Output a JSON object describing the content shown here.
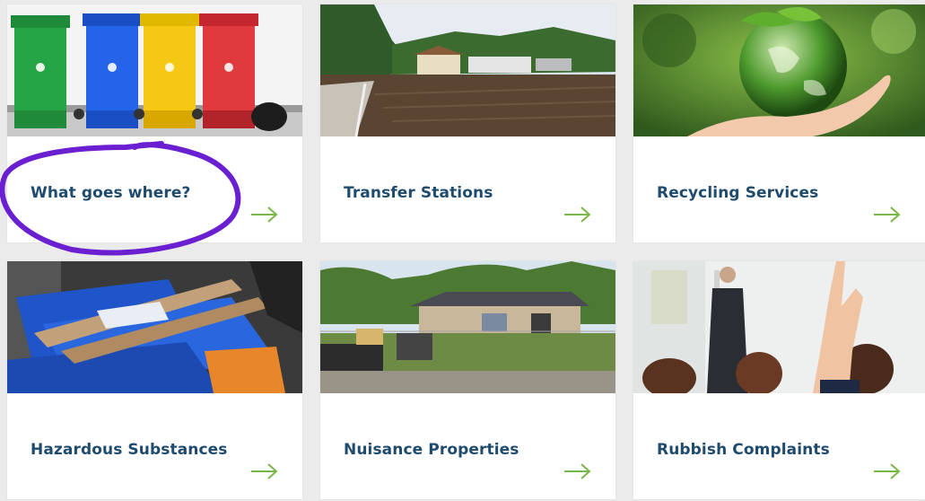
{
  "cards": [
    {
      "title": "What goes where?"
    },
    {
      "title": "Transfer Stations"
    },
    {
      "title": "Recycling Services"
    },
    {
      "title": "Hazardous Substances"
    },
    {
      "title": "Nuisance Properties"
    },
    {
      "title": "Rubbish Complaints"
    }
  ],
  "colors": {
    "title": "#1f4b6e",
    "arrow": "#7ab648",
    "annotation": "#6a1fd0",
    "card_bg": "#ffffff",
    "page_bg": "#ebebeb"
  },
  "icons": {
    "arrow": "arrow-right-icon"
  }
}
